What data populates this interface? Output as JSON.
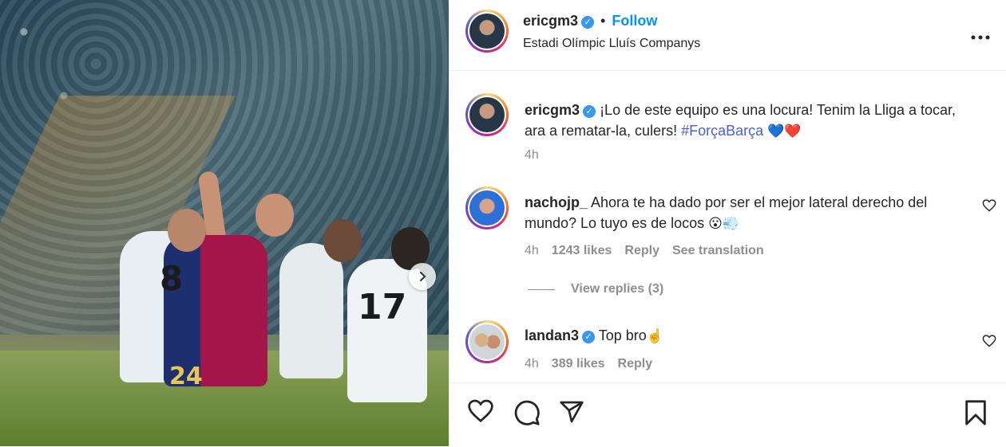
{
  "post": {
    "author": "ericgm3",
    "verified": true,
    "separator": "•",
    "follow_label": "Follow",
    "location": "Estadi Olímpic Lluís Companys",
    "more_label": "•••",
    "caption_author": "ericgm3",
    "caption_line1": "¡Lo de este equipo es una locura! Tenim la Lliga a tocar,",
    "caption_line2": "ara a rematar-la, culers! ",
    "hashtag": "#ForçaBarça",
    "caption_emojis": [
      "💙",
      "❤️"
    ],
    "caption_time": "4h"
  },
  "photo": {
    "jersey_numbers": [
      "8",
      "17",
      "24"
    ],
    "next_button_icon": "chevron-right-icon"
  },
  "comments": [
    {
      "user": "nachojp_",
      "verified": false,
      "text_line1": "Ahora te ha dado por ser el mejor lateral derecho del",
      "text_line2": "mundo? Lo tuyo es de locos ",
      "emojis": [
        "😮",
        "💨"
      ],
      "time": "4h",
      "likes": "1243 likes",
      "reply_label": "Reply",
      "translation_label": "See translation",
      "view_replies": "View replies (3)"
    },
    {
      "user": "landan3",
      "verified": true,
      "text_line1": "Top bro",
      "emojis": [
        "☝️"
      ],
      "time": "4h",
      "likes": "389 likes",
      "reply_label": "Reply"
    }
  ],
  "actions": {
    "icons": [
      "heart-icon",
      "comment-icon",
      "share-icon",
      "bookmark-icon"
    ]
  },
  "colors": {
    "link": "#0095f6",
    "hashtag": "#4b5ed3",
    "muted": "#8e8e8e",
    "verified": "#3897f0"
  }
}
